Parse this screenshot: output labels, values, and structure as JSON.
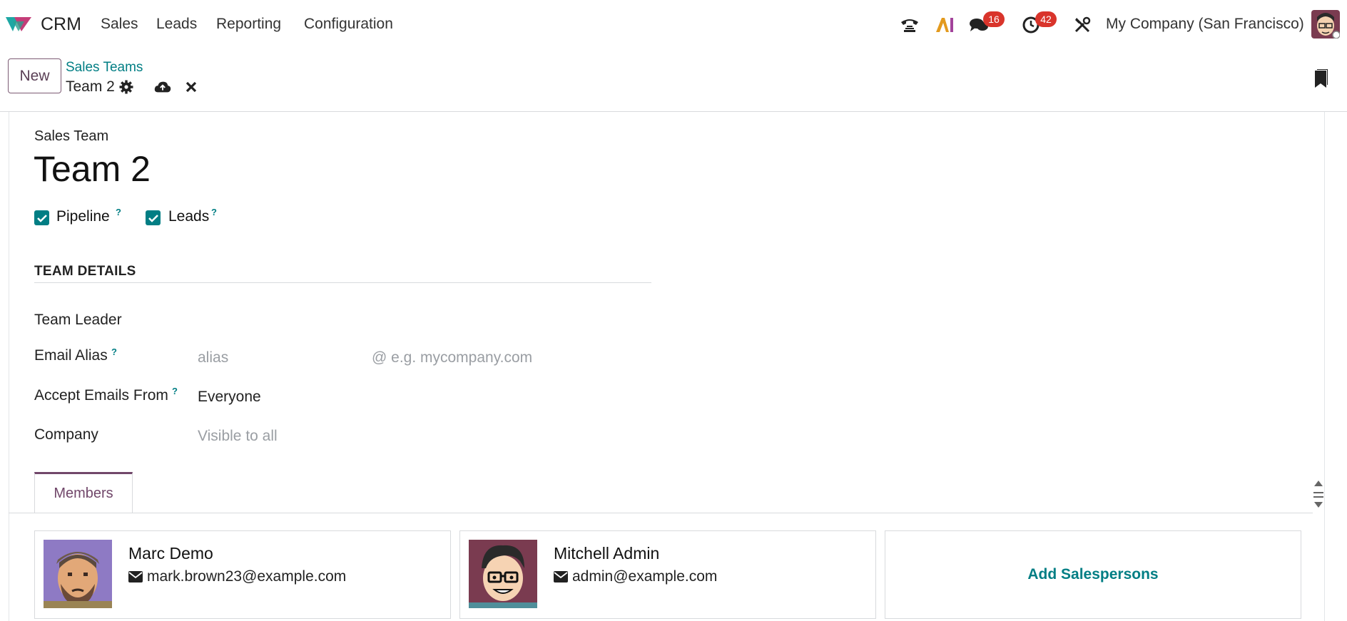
{
  "nav": {
    "app_name": "CRM",
    "menu": [
      "Sales",
      "Leads",
      "Reporting",
      "Configuration"
    ],
    "messages_count": "16",
    "activities_count": "42",
    "company": "My Company (San Francisco)",
    "icons": [
      "phone-icon",
      "ai-icon",
      "chat-icon",
      "clock-icon",
      "tools-icon"
    ]
  },
  "control": {
    "new_label": "New",
    "breadcrumb_parent": "Sales Teams",
    "breadcrumb_current": "Team 2"
  },
  "form": {
    "record_type": "Sales Team",
    "name": "Team 2",
    "checkboxes": [
      {
        "label": "Pipeline",
        "help": "?",
        "checked": true
      },
      {
        "label": "Leads",
        "help": "?",
        "checked": true
      }
    ],
    "section_title": "TEAM DETAILS",
    "fields": {
      "team_leader_label": "Team Leader",
      "email_alias_label": "Email Alias",
      "email_alias_help": "?",
      "email_alias_placeholder": "alias",
      "email_domain_placeholder": "@ e.g. mycompany.com",
      "accept_from_label": "Accept Emails From",
      "accept_from_help": "?",
      "accept_from_value": "Everyone",
      "company_label": "Company",
      "company_placeholder": "Visible to all"
    }
  },
  "tabs": {
    "members": "Members"
  },
  "members": [
    {
      "name": "Marc Demo",
      "email": "mark.brown23@example.com"
    },
    {
      "name": "Mitchell Admin",
      "email": "admin@example.com"
    }
  ],
  "add_salespersons": "Add Salespersons",
  "colors": {
    "accent": "#017e84",
    "brand": "#71476a",
    "badge": "#d9342b"
  }
}
